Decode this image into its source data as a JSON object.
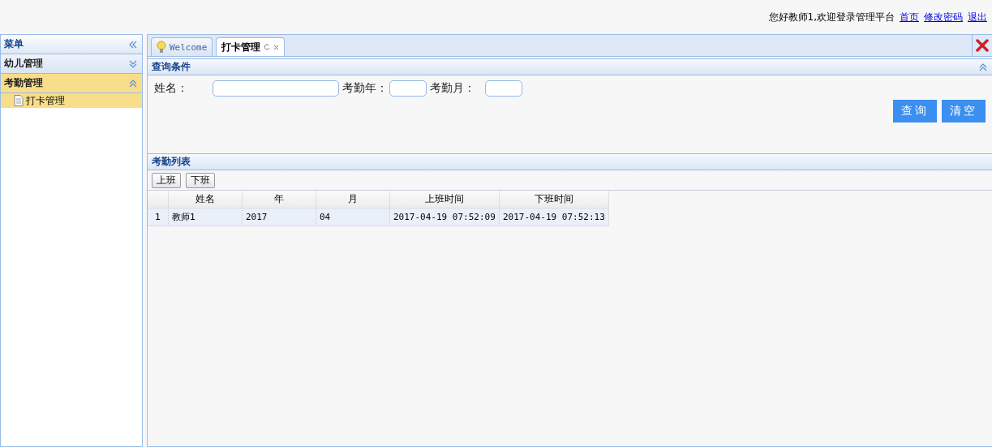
{
  "header": {
    "greeting": "您好教师1,欢迎登录管理平台",
    "links": [
      "首页",
      "修改密码",
      "退出"
    ]
  },
  "sidebar": {
    "title": "菜单",
    "sections": [
      {
        "label": "幼儿管理",
        "expanded": false,
        "selected": false
      },
      {
        "label": "考勤管理",
        "expanded": true,
        "selected": true,
        "children": [
          {
            "label": "打卡管理",
            "selected": true
          }
        ]
      }
    ]
  },
  "tabs": [
    {
      "label": "Welcome",
      "kind": "home",
      "selected": false
    },
    {
      "label": "打卡管理",
      "kind": "page",
      "selected": true
    }
  ],
  "query": {
    "title": "查询条件",
    "fields": [
      {
        "label": "姓名：",
        "kind": "wide"
      },
      {
        "label": "考勤年：",
        "kind": "short"
      },
      {
        "label": "考勤月：",
        "kind": "short"
      }
    ],
    "buttons": [
      "查询",
      "清空"
    ]
  },
  "list": {
    "title": "考勤列表",
    "toolbar": [
      "上班",
      "下班"
    ],
    "columns": [
      "姓名",
      "年",
      "月",
      "上班时间",
      "下班时间"
    ],
    "rows": [
      {
        "index": "1",
        "cells": [
          "教师1",
          "2017",
          "04",
          "2017-04-19 07:52:09",
          "2017-04-19 07:52:13"
        ],
        "selected": true
      }
    ]
  }
}
